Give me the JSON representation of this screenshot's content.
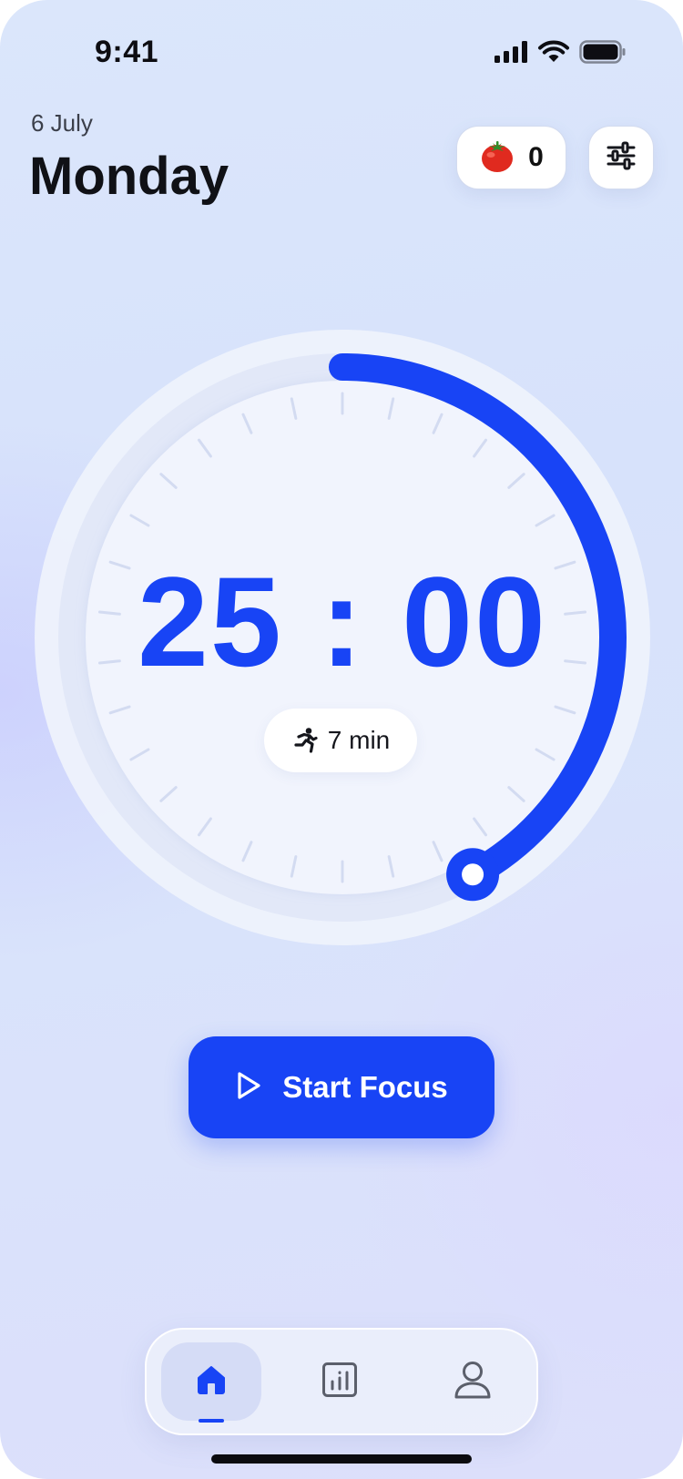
{
  "status_bar": {
    "time": "9:41",
    "icons": [
      "cellular-signal-icon",
      "wifi-icon",
      "battery-icon"
    ]
  },
  "header": {
    "date": "6 July",
    "day": "Monday"
  },
  "tomato_counter": {
    "icon": "tomato-icon",
    "count": "0"
  },
  "settings_button": {
    "icon": "sliders-icon"
  },
  "timer": {
    "display": "25 : 00",
    "progress_fraction": 0.42,
    "break_icon": "running-person-icon",
    "break_label": "7 min"
  },
  "start_button": {
    "icon": "play-icon",
    "label": "Start Focus"
  },
  "tab_bar": {
    "tabs": [
      {
        "name": "home",
        "icon": "home-icon",
        "active": true
      },
      {
        "name": "stats",
        "icon": "stats-icon",
        "active": false
      },
      {
        "name": "profile",
        "icon": "user-icon",
        "active": false
      }
    ]
  },
  "colors": {
    "accent": "#1844f5",
    "text_dark": "#101116",
    "dial_face": "#f1f4fd",
    "dial_ring": "#e2e8f8"
  }
}
